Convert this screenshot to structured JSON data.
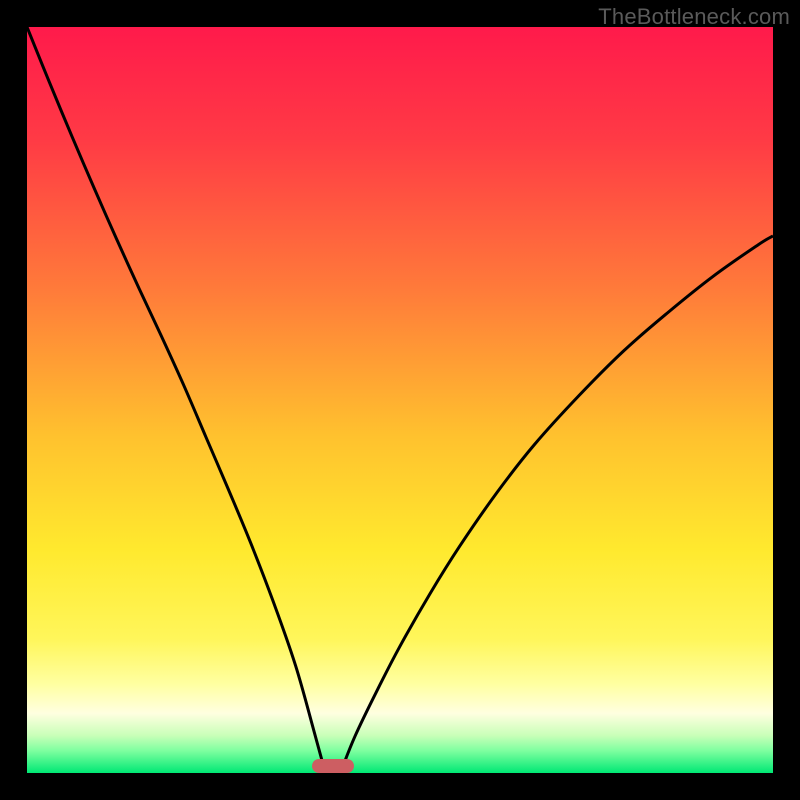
{
  "watermark": "TheBottleneck.com",
  "colors": {
    "gradient_stops": [
      {
        "pct": 0,
        "color": "#ff1a4b"
      },
      {
        "pct": 15,
        "color": "#ff3a45"
      },
      {
        "pct": 35,
        "color": "#ff7a3a"
      },
      {
        "pct": 55,
        "color": "#ffc22e"
      },
      {
        "pct": 70,
        "color": "#ffe92e"
      },
      {
        "pct": 82,
        "color": "#fff65a"
      },
      {
        "pct": 88,
        "color": "#ffffa0"
      },
      {
        "pct": 92,
        "color": "#ffffe0"
      },
      {
        "pct": 95,
        "color": "#c8ffb8"
      },
      {
        "pct": 97,
        "color": "#7fffa0"
      },
      {
        "pct": 100,
        "color": "#00e874"
      }
    ],
    "curve": "#000000",
    "marker": "#cd5e62",
    "frame": "#000000"
  },
  "chart_data": {
    "type": "line",
    "title": "",
    "xlabel": "",
    "ylabel": "",
    "xlim": [
      0,
      100
    ],
    "ylim": [
      0,
      100
    ],
    "series": [
      {
        "name": "left-branch",
        "x": [
          0,
          3,
          6,
          9,
          12,
          15,
          18,
          21,
          24,
          27,
          30,
          33,
          36,
          38.5,
          40
        ],
        "y": [
          100,
          92.6,
          85.4,
          78.4,
          71.6,
          65.0,
          58.6,
          52.0,
          45.0,
          38.0,
          30.8,
          23.0,
          14.4,
          5.5,
          0
        ]
      },
      {
        "name": "right-branch",
        "x": [
          42,
          44,
          47,
          50,
          54,
          58,
          63,
          68,
          74,
          80,
          86,
          92,
          98,
          100
        ],
        "y": [
          0,
          5.0,
          11.2,
          17.0,
          24.0,
          30.4,
          37.6,
          44.0,
          50.6,
          56.6,
          61.8,
          66.6,
          70.8,
          72.0
        ]
      }
    ],
    "marker": {
      "x": 41,
      "y": 1
    }
  }
}
